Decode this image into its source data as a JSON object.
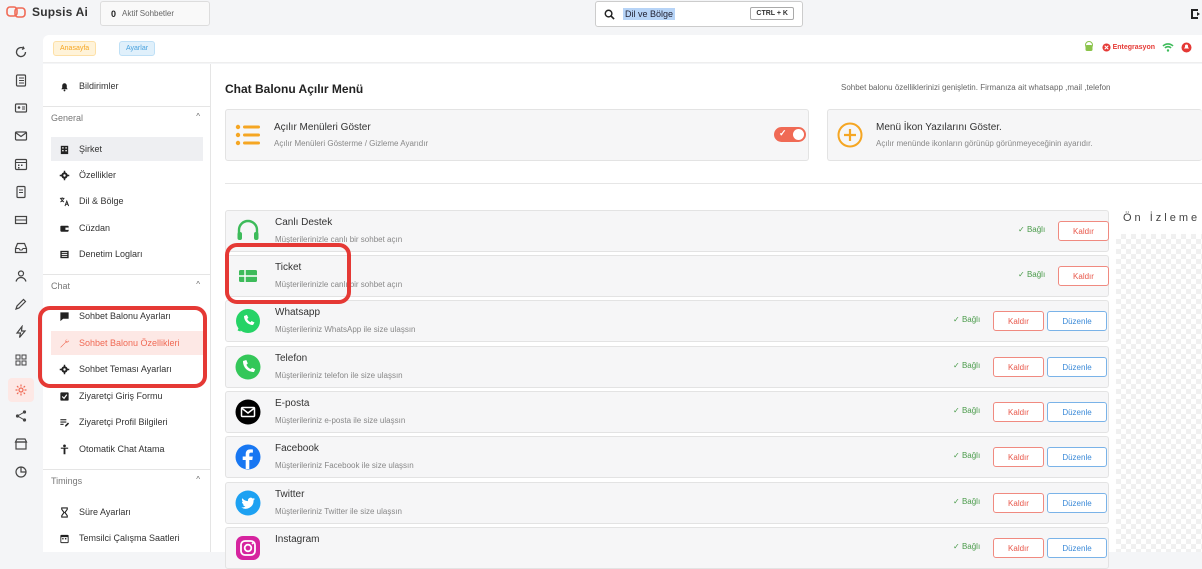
{
  "app": {
    "name": "Supsis Ai"
  },
  "top": {
    "active_count": "0",
    "active_label": "Aktif Sohbetler",
    "search_text": "Dil ve Bölge",
    "search_shortcut": "CTRL + K"
  },
  "header": {
    "home": "Anasayfa",
    "settings": "Ayarlar",
    "integration": "Entegrasyon"
  },
  "sidebar": {
    "notifications": "Bildirimler",
    "groups": {
      "general": "General",
      "chat": "Chat",
      "timings": "Timings"
    },
    "general_items": [
      "Şirket",
      "Özellikler",
      "Dil & Bölge",
      "Cüzdan",
      "Denetim Logları"
    ],
    "chat_items": [
      "Sohbet Balonu Ayarları",
      "Sohbet Balonu Özellikleri",
      "Sohbet Teması Ayarları",
      "Ziyaretçi Giriş Formu",
      "Ziyaretçi Profil Bilgileri",
      "Otomatik Chat Atama"
    ],
    "timings_items": [
      "Süre Ayarları",
      "Temsilci Çalışma Saatleri"
    ]
  },
  "main": {
    "title": "Chat Balonu Açılır Menü",
    "description": "Sohbet balonu özelliklerinizi genişletin. Firmanıza ait whatsapp ,mail ,telefon",
    "options": [
      {
        "title": "Açılır Menüleri Göster",
        "subtitle": "Açılır Menüleri Gösterme / Gizleme Ayarıdır"
      },
      {
        "title": "Menü İkon Yazılarını Göster.",
        "subtitle": "Açılır menünde ikonların görünüp görünmeyeceğinin ayarıdır."
      }
    ],
    "preview_title": "Ön İzleme",
    "status_label": "Bağlı",
    "remove_label": "Kaldır",
    "edit_label": "Düzenle",
    "channels": [
      {
        "title": "Canlı Destek",
        "subtitle": "Müşterilerinizle canlı bir sohbet açın",
        "icon": "headset-icon",
        "color": "#3dbb5a"
      },
      {
        "title": "Ticket",
        "subtitle": "Müşterilerinizle canlı bir sohbet açın",
        "icon": "ticket-icon",
        "color": "#3dbb5a"
      },
      {
        "title": "Whatsapp",
        "subtitle": "Müşterileriniz WhatsApp ile size ulaşsın",
        "icon": "whatsapp-icon",
        "color": "#25d366"
      },
      {
        "title": "Telefon",
        "subtitle": "Müşterileriniz telefon ile size ulaşsın",
        "icon": "phone-icon",
        "color": "#34c759"
      },
      {
        "title": "E-posta",
        "subtitle": "Müşterileriniz e-posta ile size ulaşsın",
        "icon": "email-icon",
        "color": "#000000"
      },
      {
        "title": "Facebook",
        "subtitle": "Müşterileriniz Facebook ile size ulaşsın",
        "icon": "facebook-icon",
        "color": "#1877f2"
      },
      {
        "title": "Twitter",
        "subtitle": "Müşterileriniz Twitter ile size ulaşsın",
        "icon": "twitter-icon",
        "color": "#1da1f2"
      },
      {
        "title": "Instagram",
        "subtitle": "",
        "icon": "instagram-icon",
        "color": "#d6249f"
      }
    ]
  },
  "colors": {
    "accent": "#f06a55",
    "connected": "#4a9b4a",
    "remove": "#e8574a",
    "edit": "#3b8ad8",
    "highlight": "#e53935"
  }
}
